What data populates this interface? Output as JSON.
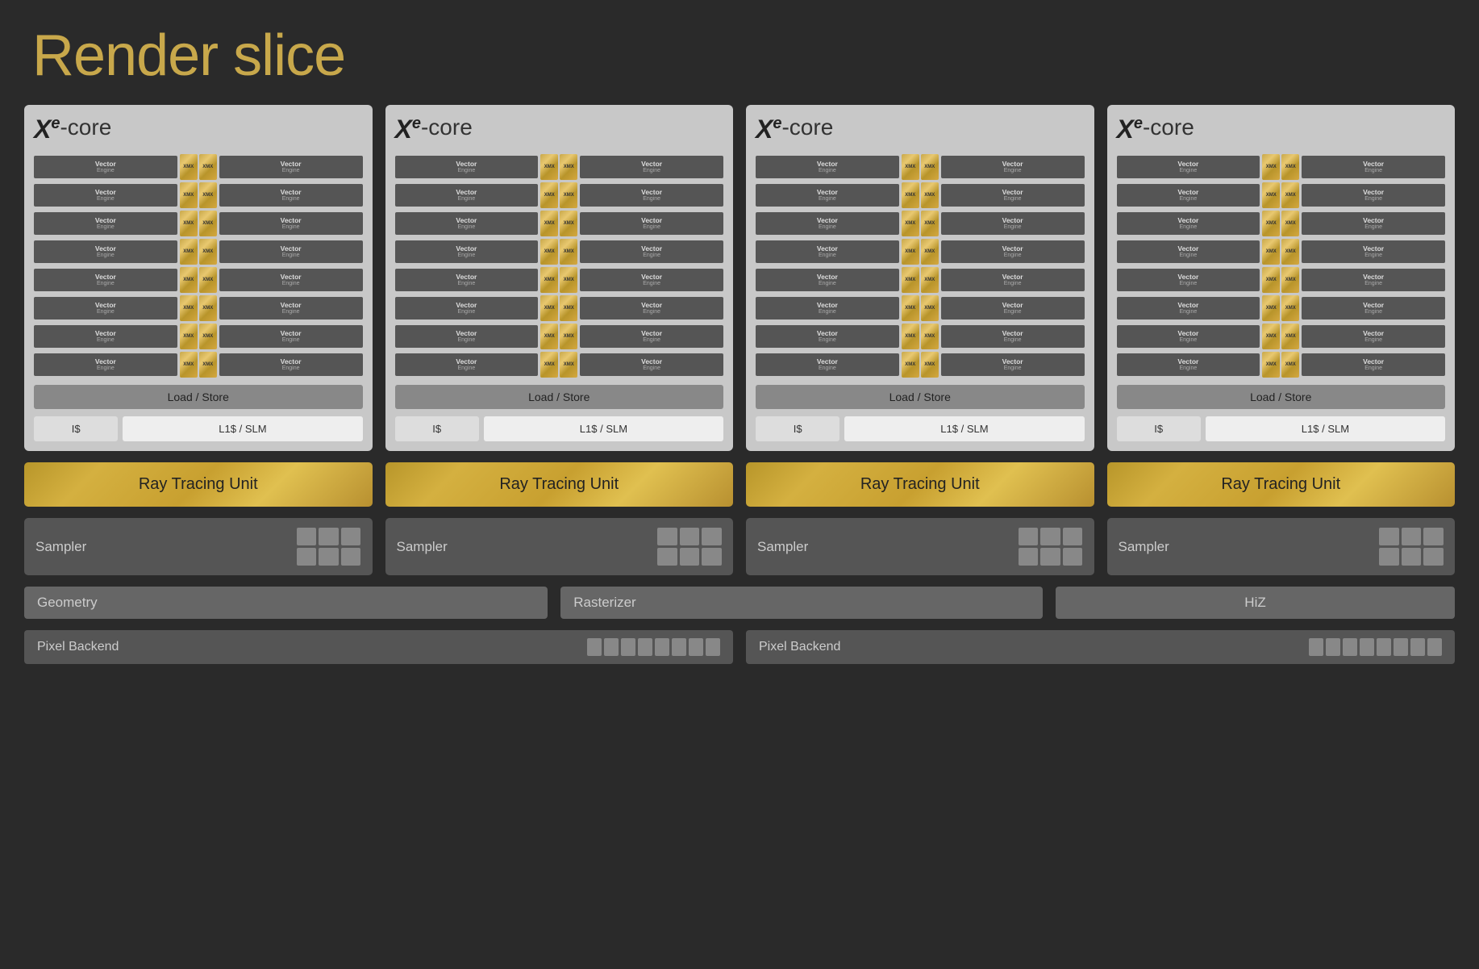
{
  "title": "Render slice",
  "xe_cores": [
    {
      "id": "xe-core-1",
      "label": "Xe-core",
      "load_store": "Load / Store",
      "i_cache": "I$",
      "l1_cache": "L1$ / SLM"
    },
    {
      "id": "xe-core-2",
      "label": "Xe-core",
      "load_store": "Load / Store",
      "i_cache": "I$",
      "l1_cache": "L1$ / SLM"
    },
    {
      "id": "xe-core-3",
      "label": "Xe-core",
      "load_store": "Load / Store",
      "i_cache": "I$",
      "l1_cache": "L1$ / SLM"
    },
    {
      "id": "xe-core-4",
      "label": "Xe-core",
      "load_store": "Load / Store",
      "i_cache": "I$",
      "l1_cache": "L1$ / SLM"
    }
  ],
  "ray_tracing_units": [
    {
      "label": "Ray Tracing Unit"
    },
    {
      "label": "Ray Tracing Unit"
    },
    {
      "label": "Ray Tracing Unit"
    },
    {
      "label": "Ray Tracing Unit"
    }
  ],
  "samplers": [
    {
      "label": "Sampler"
    },
    {
      "label": "Sampler"
    },
    {
      "label": "Sampler"
    },
    {
      "label": "Sampler"
    }
  ],
  "bottom": {
    "geometry": "Geometry",
    "rasterizer": "Rasterizer",
    "hiz": "HiZ",
    "pixel_backend_1": "Pixel Backend",
    "pixel_backend_2": "Pixel Backend"
  },
  "engine_rows": [
    {
      "left": "Vector",
      "left_sub": "Engine",
      "right": "Vector",
      "right_sub": "Engine"
    },
    {
      "left": "Vector",
      "left_sub": "Engine",
      "right": "Vector",
      "right_sub": "Engine"
    },
    {
      "left": "Vector",
      "left_sub": "Engine",
      "right": "Vector",
      "right_sub": "Engine"
    },
    {
      "left": "Vector",
      "left_sub": "Engine",
      "right": "Vector",
      "right_sub": "Engine"
    },
    {
      "left": "Vector",
      "left_sub": "Engine",
      "right": "Vector",
      "right_sub": "Engine"
    },
    {
      "left": "Vector",
      "left_sub": "Engine",
      "right": "Vector",
      "right_sub": "Engine"
    },
    {
      "left": "Vector",
      "left_sub": "Engine",
      "right": "Vector",
      "right_sub": "Engine"
    },
    {
      "left": "Vector",
      "left_sub": "Engine",
      "right": "Vector",
      "right_sub": "Engine"
    }
  ]
}
